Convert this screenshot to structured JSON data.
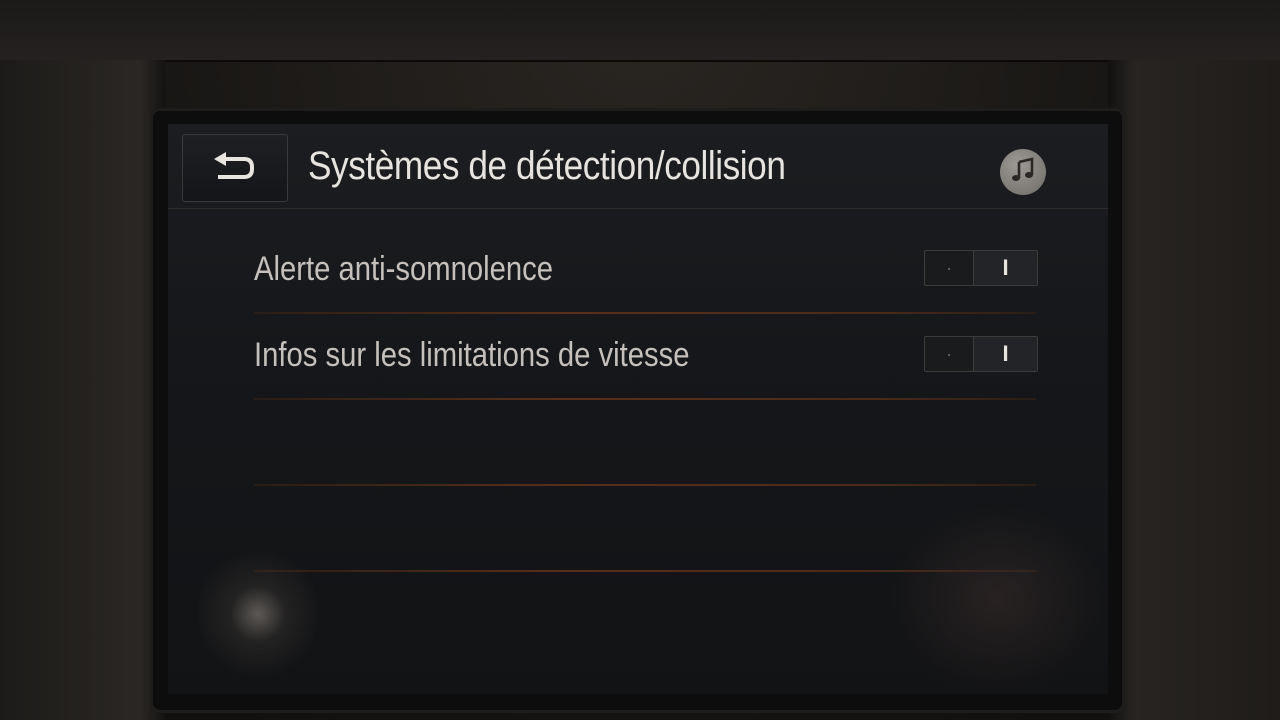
{
  "header": {
    "title": "Systèmes de détection/collision",
    "back_icon": "back-arrow-icon",
    "media_icon": "music-note-icon"
  },
  "settings": [
    {
      "label": "Alerte anti-somnolence",
      "off_mark": "·",
      "on_mark": "I",
      "state": "on"
    },
    {
      "label": "Infos sur les limitations de vitesse",
      "off_mark": "·",
      "on_mark": "I",
      "state": "on"
    }
  ],
  "colors": {
    "text": "#c5c0bb",
    "title": "#e7e3de",
    "divider_accent": "#5a2f1a"
  }
}
